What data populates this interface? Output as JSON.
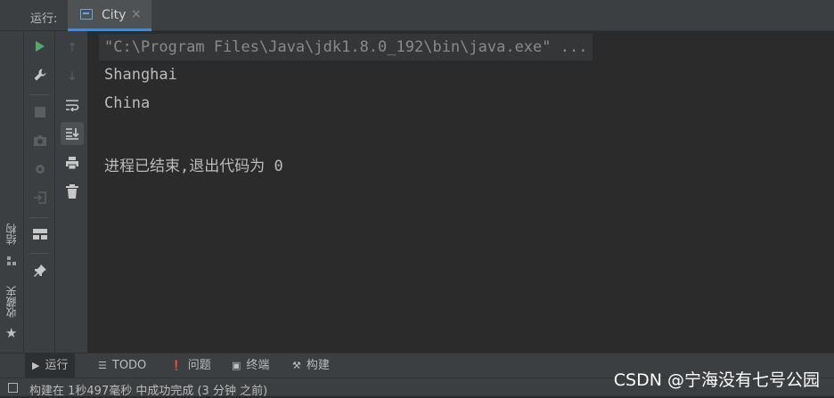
{
  "header": {
    "run_label": "运行:",
    "tab_title": "City",
    "tab_close": "×"
  },
  "left_strip": {
    "structure_label": "结构",
    "favorites_label": "收藏夹"
  },
  "console": {
    "command": "\"C:\\Program Files\\Java\\jdk1.8.0_192\\bin\\java.exe\" ...",
    "output": [
      "Shanghai",
      "China"
    ],
    "exit_message": "进程已结束,退出代码为 0"
  },
  "bottom_tabs": [
    {
      "label": "运行",
      "icon": "play-icon"
    },
    {
      "label": "TODO",
      "icon": "list-icon"
    },
    {
      "label": "问题",
      "icon": "alert-icon"
    },
    {
      "label": "终端",
      "icon": "terminal-icon"
    },
    {
      "label": "构建",
      "icon": "hammer-icon"
    }
  ],
  "status": {
    "text": "构建在 1秒497毫秒 中成功完成 (3 分钟 之前)"
  },
  "watermark": "CSDN @宁海没有七号公园",
  "colors": {
    "background": "#2b2b2b",
    "panel": "#3c3f41",
    "accent": "#4a88c7",
    "run_green": "#59a869"
  }
}
